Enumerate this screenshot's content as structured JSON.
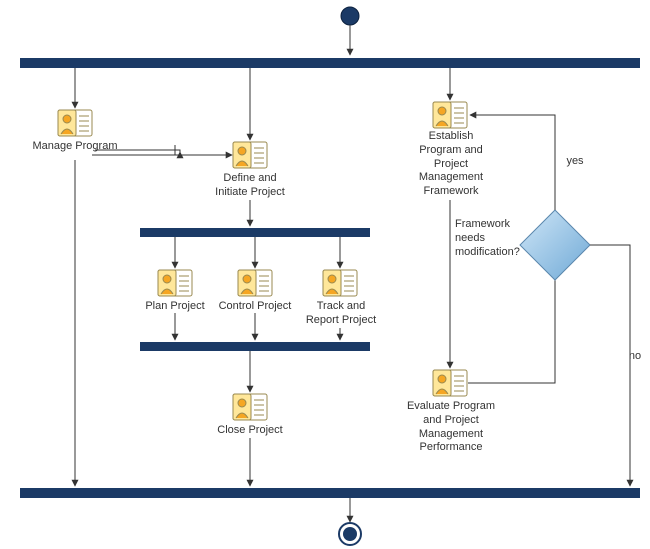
{
  "nodes": {
    "manageProgram": "Manage Program",
    "defineInitiate": "Define and\nInitiate Project",
    "planProject": "Plan Project",
    "controlProject": "Control Project",
    "trackReport": "Track and\nReport Project",
    "closeProject": "Close Project",
    "establishFramework": "Establish\nProgram and\nProject\nManagement\nFramework",
    "evaluatePerformance": "Evaluate Program\nand Project\nManagement\nPerformance",
    "decision": "Framework\nneeds\nmodification?"
  },
  "edges": {
    "yes": "yes",
    "no": "no"
  },
  "chart_data": {
    "type": "area",
    "notation": "UML activity diagram",
    "initial_node": "start",
    "final_node": "end",
    "fork_bars": [
      "fork1 (top)",
      "fork2 (inner upper)",
      "join2 (inner lower)",
      "join1 (bottom)"
    ],
    "activities": [
      "Manage Program",
      "Define and Initiate Project",
      "Plan Project",
      "Control Project",
      "Track and Report Project",
      "Close Project",
      "Establish Program and Project Management Framework",
      "Evaluate Program and Project Management Performance"
    ],
    "decision": {
      "text": "Framework needs modification?",
      "branches": {
        "yes": "Establish Program and Project Management Framework",
        "no": "join1 (bottom)"
      }
    },
    "flows": [
      [
        "start",
        "fork1"
      ],
      [
        "fork1",
        "Manage Program"
      ],
      [
        "fork1",
        "Define and Initiate Project"
      ],
      [
        "fork1",
        "Establish Program and Project Management Framework"
      ],
      [
        "Manage Program",
        "Define and Initiate Project"
      ],
      [
        "Manage Program",
        "join1"
      ],
      [
        "Define and Initiate Project",
        "fork2"
      ],
      [
        "fork2",
        "Plan Project"
      ],
      [
        "fork2",
        "Control Project"
      ],
      [
        "fork2",
        "Track and Report Project"
      ],
      [
        "Plan Project",
        "join2"
      ],
      [
        "Control Project",
        "join2"
      ],
      [
        "Track and Report Project",
        "join2"
      ],
      [
        "join2",
        "Close Project"
      ],
      [
        "Close Project",
        "join1"
      ],
      [
        "Establish Program and Project Management Framework",
        "Evaluate Program and Project Management Performance"
      ],
      [
        "Evaluate Program and Project Management Performance",
        "Framework needs modification?"
      ],
      [
        "Framework needs modification?",
        "Establish Program and Project Management Framework",
        "yes"
      ],
      [
        "Framework needs modification?",
        "join1",
        "no"
      ],
      [
        "join1",
        "end"
      ]
    ]
  }
}
